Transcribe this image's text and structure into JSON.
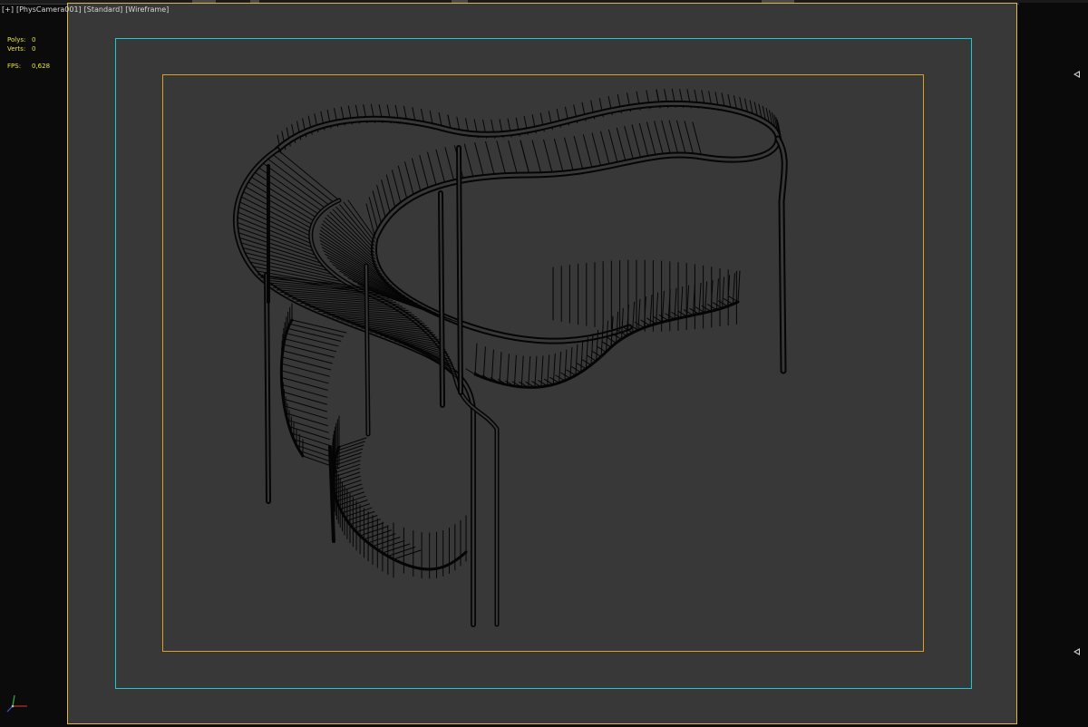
{
  "viewport": {
    "label_parts": [
      "[+]",
      "[PhysCamera001]",
      "[Standard]",
      "[Wireframe]"
    ],
    "mode": "Wireframe",
    "shading": "Standard",
    "camera": "PhysCamera001"
  },
  "stats": {
    "polys_label": "Polys:",
    "polys_value": "0",
    "verts_label": "Verts:",
    "verts_value": "0",
    "fps_label": "FPS:",
    "fps_value": "0,628"
  },
  "colors": {
    "viewport_bg": "#383838",
    "safe_frame_outer": "#1ec8d0",
    "safe_frame_inner": "#d9a022",
    "viewport_border": "#e3b64a",
    "stats_text": "#e8e640",
    "wireframe": "#000000"
  },
  "icons": {
    "axis_gizmo": "axis-tripod-icon",
    "right_markers": "triangle-left-icon"
  }
}
